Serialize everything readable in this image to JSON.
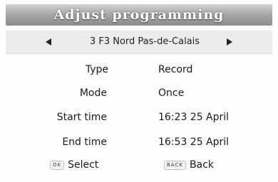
{
  "title": "Adjust programming",
  "channel": {
    "name": "3 F3 Nord Pas-de-Calais"
  },
  "fields": {
    "type": {
      "label": "Type",
      "value": "Record"
    },
    "mode": {
      "label": "Mode",
      "value": "Once"
    },
    "start": {
      "label": "Start time",
      "value": "16:23 25 April"
    },
    "end": {
      "label": "End time",
      "value": "16:53 25 April"
    }
  },
  "buttons": {
    "select": {
      "key": "OK",
      "label": "Select"
    },
    "back": {
      "key": "BACK",
      "label": "Back"
    }
  },
  "icons": {
    "left": "arrow-left-icon",
    "right": "arrow-right-icon"
  }
}
